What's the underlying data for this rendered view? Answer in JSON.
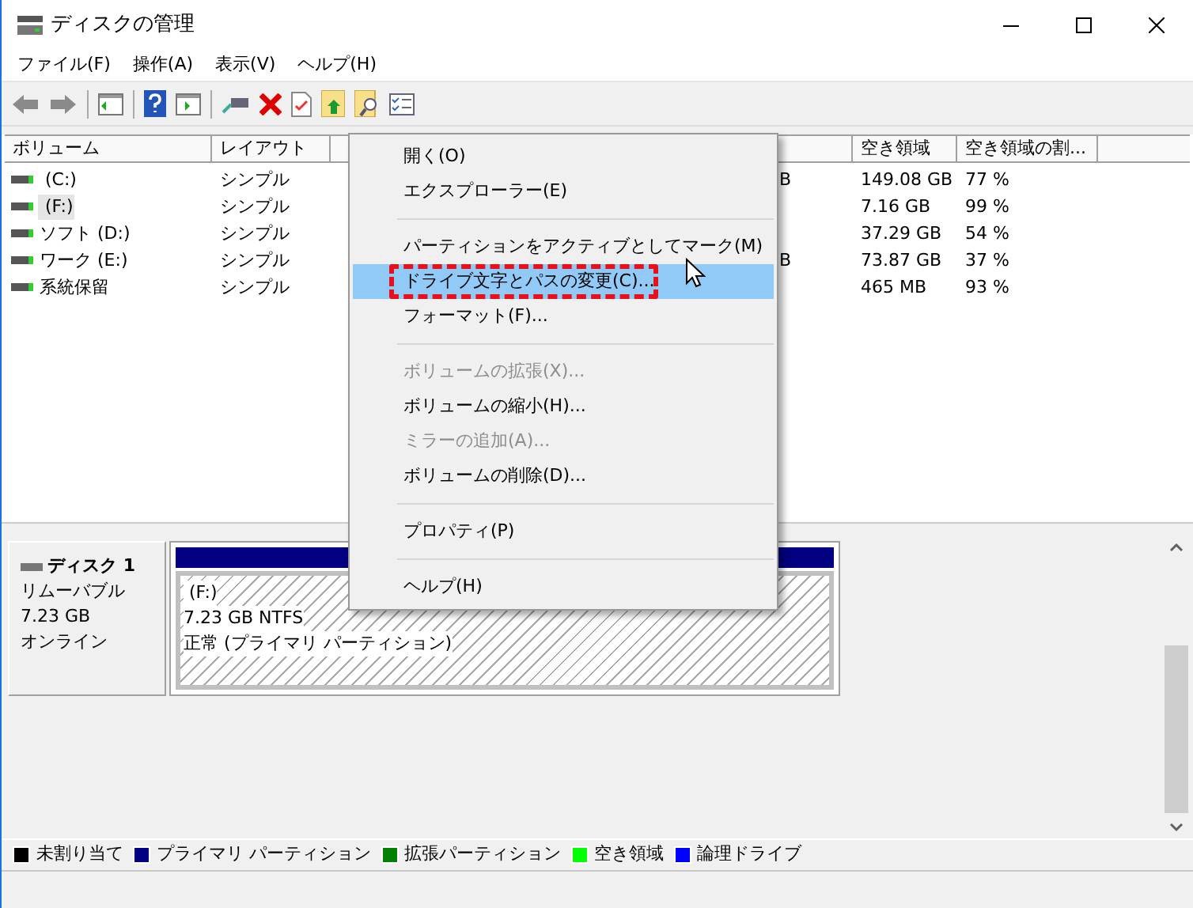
{
  "window": {
    "title": "ディスクの管理"
  },
  "menubar": [
    "ファイル(F)",
    "操作(A)",
    "表示(V)",
    "ヘルプ(H)"
  ],
  "table": {
    "columns": [
      "ボリューム",
      "レイアウト",
      null,
      "空き領域",
      "空き領域の割..."
    ],
    "rows": [
      {
        "volume": " (C:)",
        "layout": "シンプル",
        "column_4": "B",
        "free": "149.08 GB",
        "free_pct": "77 %",
        "selected": false
      },
      {
        "volume": " (F:)",
        "layout": "シンプル",
        "free": "7.16 GB",
        "free_pct": "99 %",
        "selected": true
      },
      {
        "volume": "ソフト (D:)",
        "layout": "シンプル",
        "free": "37.29 GB",
        "free_pct": "54 %",
        "selected": false
      },
      {
        "volume": "ワーク (E:)",
        "layout": "シンプル",
        "column_4": "B",
        "free": "73.87 GB",
        "free_pct": "37 %",
        "selected": false
      },
      {
        "volume": "系統保留",
        "layout": "シンプル",
        "free": "465 MB",
        "free_pct": "93 %",
        "selected": false
      }
    ]
  },
  "context_menu": {
    "items": [
      {
        "kind": "item",
        "label": "開く(O)",
        "disabled": false,
        "selected": false
      },
      {
        "kind": "item",
        "label": "エクスプローラー(E)",
        "disabled": false,
        "selected": false
      },
      {
        "kind": "separator"
      },
      {
        "kind": "item",
        "label": "パーティションをアクティブとしてマーク(M)",
        "disabled": false,
        "selected": false
      },
      {
        "kind": "item",
        "label": "ドライブ文字とパスの変更(C)...",
        "disabled": false,
        "selected": true,
        "annotated": true
      },
      {
        "kind": "item",
        "label": "フォーマット(F)...",
        "disabled": false,
        "selected": false
      },
      {
        "kind": "separator"
      },
      {
        "kind": "item",
        "label": "ボリュームの拡張(X)...",
        "disabled": true,
        "selected": false
      },
      {
        "kind": "item",
        "label": "ボリュームの縮小(H)...",
        "disabled": false,
        "selected": false
      },
      {
        "kind": "item",
        "label": "ミラーの追加(A)...",
        "disabled": true,
        "selected": false
      },
      {
        "kind": "item",
        "label": "ボリュームの削除(D)...",
        "disabled": false,
        "selected": false
      },
      {
        "kind": "separator"
      },
      {
        "kind": "item",
        "label": "プロパティ(P)",
        "disabled": false,
        "selected": false
      },
      {
        "kind": "separator"
      },
      {
        "kind": "item",
        "label": "ヘルプ(H)",
        "disabled": false,
        "selected": false
      }
    ]
  },
  "disk": {
    "name": "ディスク 1",
    "type": "リムーバブル",
    "size": "7.23 GB",
    "status": "オンライン",
    "partition": {
      "name": " (F:)",
      "size_fs": "7.23 GB NTFS",
      "status": "正常 (プライマリ パーティション)"
    }
  },
  "legend": [
    {
      "label": "未割り当て",
      "color": "#000000"
    },
    {
      "label": "プライマリ パーティション",
      "color": "#000080"
    },
    {
      "label": "拡張パーティション",
      "color": "#008000"
    },
    {
      "label": "空き領域",
      "color": "#00ff00"
    },
    {
      "label": "論理ドライブ",
      "color": "#0000ff"
    }
  ]
}
